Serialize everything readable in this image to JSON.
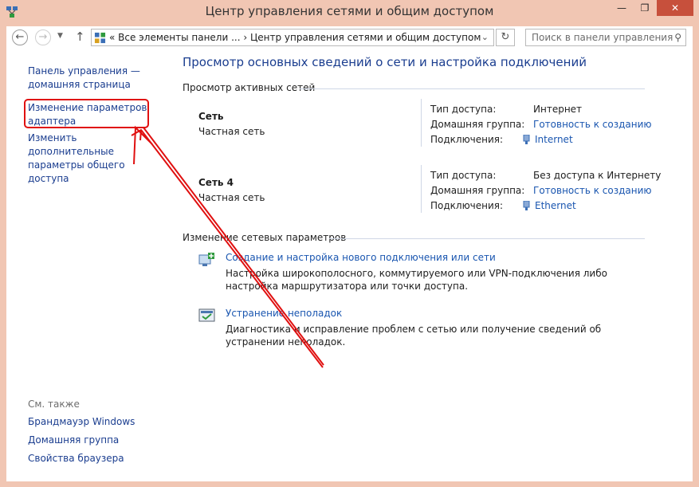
{
  "window": {
    "title": "Центр управления сетями и общим доступом",
    "minimize": "—",
    "maximize": "❐",
    "close": "✕"
  },
  "nav": {
    "address_text": "«  Все элементы панели ...  ›  Центр управления сетями и общим доступом",
    "search_placeholder": "Поиск в панели управления"
  },
  "sidebar": {
    "home_link": "Панель управления — домашняя страница",
    "adapter_link": "Изменение параметров адаптера",
    "sharing_link": "Изменить дополнительные параметры общего доступа",
    "see_also": "См. также",
    "see_also_links": [
      "Брандмауэр Windows",
      "Домашняя группа",
      "Свойства браузера"
    ]
  },
  "main": {
    "title": "Просмотр основных сведений о сети и настройка подключений",
    "active_networks_header": "Просмотр активных сетей",
    "networks": [
      {
        "name": "Сеть",
        "type": "Частная сеть",
        "access_label": "Тип доступа:",
        "access_value": "Интернет",
        "homegroup_label": "Домашняя группа:",
        "homegroup_value": "Готовность к созданию",
        "connections_label": "Подключения:",
        "connections_value": "Internet"
      },
      {
        "name": "Сеть  4",
        "type": "Частная сеть",
        "access_label": "Тип доступа:",
        "access_value": "Без доступа к Интернету",
        "homegroup_label": "Домашняя группа:",
        "homegroup_value": "Готовность к созданию",
        "connections_label": "Подключения:",
        "connections_value": "Ethernet"
      }
    ],
    "change_settings_header": "Изменение сетевых параметров",
    "tasks": [
      {
        "link": "Создание и настройка нового подключения или сети",
        "desc": "Настройка широкополосного, коммутируемого или VPN-подключения либо настройка маршрутизатора или точки доступа."
      },
      {
        "link": "Устранение неполадок",
        "desc": "Диагностика и исправление проблем с сетью или получение сведений об устранении неполадок."
      }
    ]
  },
  "colors": {
    "frame": "#f1c6b3",
    "link": "#1a56b0",
    "annotation": "#e01010"
  }
}
